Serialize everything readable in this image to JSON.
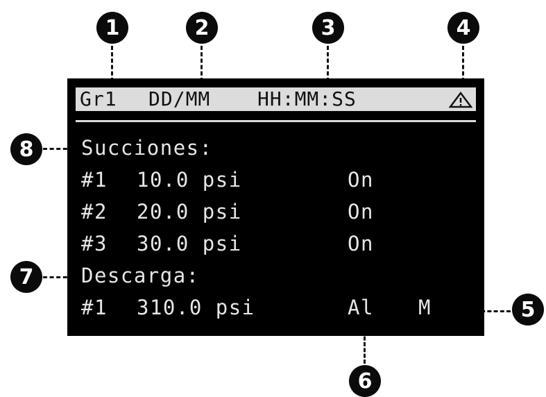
{
  "callouts": [
    "1",
    "2",
    "3",
    "4",
    "5",
    "6",
    "7",
    "8"
  ],
  "header": {
    "group": "Gr1",
    "date": "DD/MM",
    "time": "HH:MM:SS",
    "alarm_icon": "warning-triangle-icon"
  },
  "suction": {
    "title": "Succiones:",
    "rows": [
      {
        "id": "#1",
        "value": "10.0 psi",
        "state": "On"
      },
      {
        "id": "#2",
        "value": "20.0 psi",
        "state": "On"
      },
      {
        "id": "#3",
        "value": "30.0 psi",
        "state": "On"
      }
    ]
  },
  "discharge": {
    "title": "Descarga:",
    "rows": [
      {
        "id": "#1",
        "value": "310.0 psi",
        "state": "Al",
        "mode": "M"
      }
    ]
  },
  "colors": {
    "screen": "#000000",
    "text": "#e6e6e6",
    "statusbar": "#dcdcdc",
    "callout": "#0b0b0b"
  }
}
